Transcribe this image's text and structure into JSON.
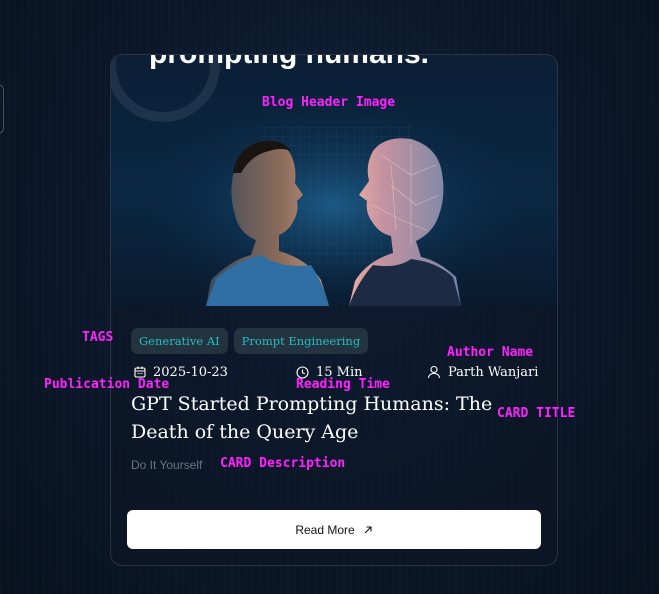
{
  "card": {
    "hero_overlay_text": "prompting humans.",
    "tags": [
      "Generative AI",
      "Prompt Engineering"
    ],
    "date": "2025-10-23",
    "reading_time": "15 Min",
    "author": "Parth Wanjari",
    "title": "GPT Started Prompting Humans: The Death of the Query Age",
    "description": "Do It Yourself",
    "read_more_label": "Read More"
  },
  "annotations": {
    "header_image": "Blog Header Image",
    "tags": "TAGS",
    "author_name": "Author Name",
    "publication_date": "Publication Date",
    "reading_time": "Reading Time",
    "card_title": "CARD TITLE",
    "card_description": "CARD Description"
  },
  "colors": {
    "background": "#0a1526",
    "tag_bg": "#233340",
    "tag_text": "#25c0c0",
    "annotation": "#ff22ff",
    "button_bg": "#ffffff"
  },
  "icons": [
    "calendar-icon",
    "clock-icon",
    "user-icon",
    "arrow-up-right-icon"
  ]
}
